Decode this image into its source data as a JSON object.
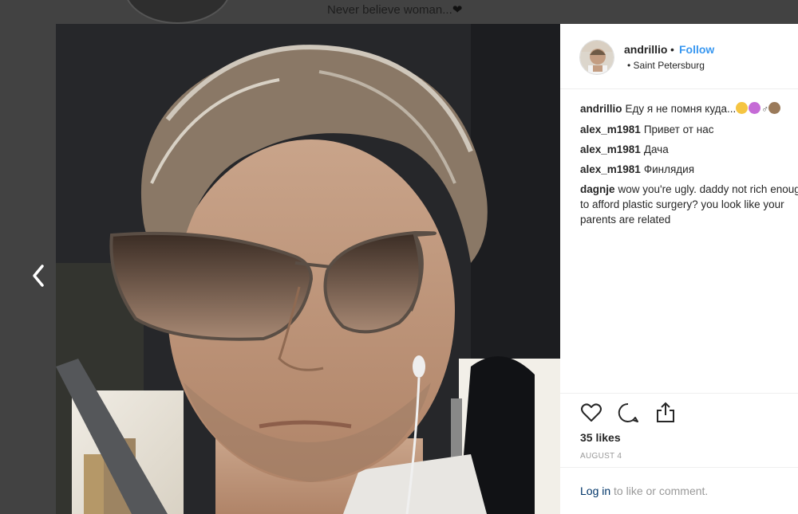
{
  "background": {
    "caption": "Never believe woman...",
    "caption_icon": "black-heart-icon"
  },
  "navigation": {
    "prev_icon": "chevron-left-icon"
  },
  "post": {
    "author": "andrillio",
    "separator": "•",
    "follow_label": "Follow",
    "location": "• Saint Petersburg",
    "comments": [
      {
        "user": "andrillio",
        "text": "Еду я не помня куда...",
        "emojis": [
          "#f5c542",
          "#c56bd6",
          "#9a7a5a",
          "#f5c542"
        ]
      },
      {
        "user": "alex_m1981",
        "text": "Привет от нас"
      },
      {
        "user": "alex_m1981",
        "text": "Дача"
      },
      {
        "user": "alex_m1981",
        "text": "Финлядия"
      },
      {
        "user": "dagnje",
        "text": "wow you're ugly. daddy not rich enough to afford plastic surgery? you look like your parents are related"
      }
    ],
    "actions": {
      "like_icon": "heart-outline-icon",
      "comment_icon": "comment-bubble-icon",
      "share_icon": "share-icon"
    },
    "likes": "35 likes",
    "date": "AUGUST 4",
    "login_link": "Log in",
    "login_text": " to like or comment."
  },
  "colors": {
    "overlay": "#424242",
    "follow": "#3897f0",
    "link": "#003569",
    "muted": "#999999"
  }
}
